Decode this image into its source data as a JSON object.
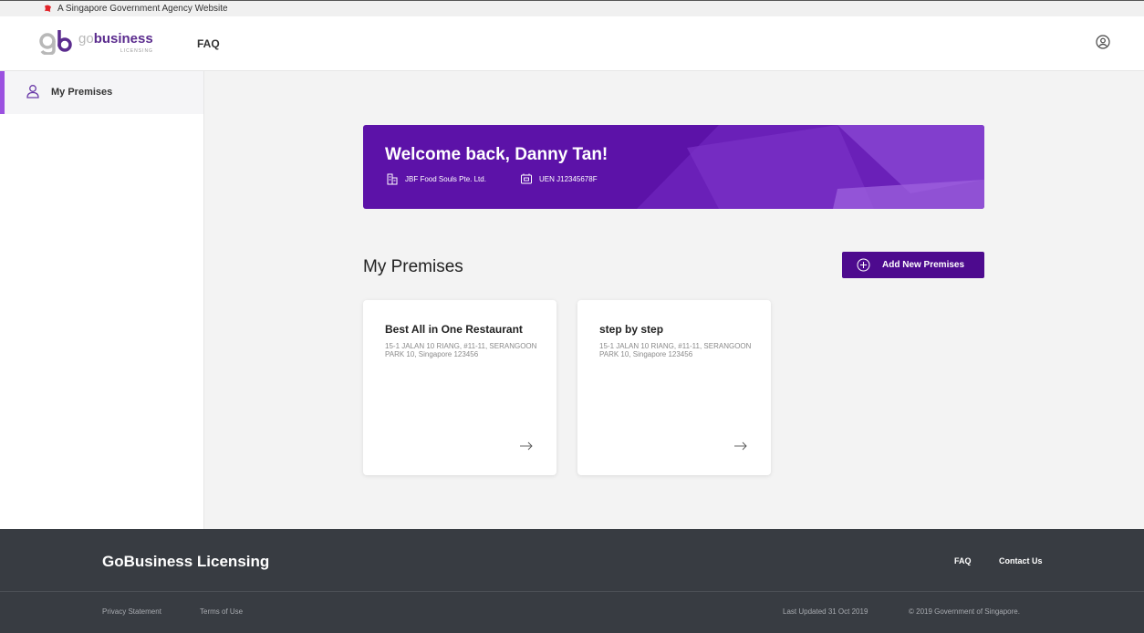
{
  "gov_bar": {
    "text": "A Singapore Government Agency Website"
  },
  "header": {
    "brand_go": "go",
    "brand_business": "business",
    "brand_sub": "LICENSING",
    "faq_label": "FAQ"
  },
  "sidebar": {
    "items": [
      {
        "label": "My Premises",
        "icon": "user-icon"
      }
    ]
  },
  "banner": {
    "title": "Welcome back, Danny Tan!",
    "company": "JBF Food Souls Pte. Ltd.",
    "uen": "UEN J12345678F"
  },
  "main": {
    "section_title": "My Premises",
    "add_button_label": "Add New Premises"
  },
  "premises": [
    {
      "name": "Best All in One Restaurant",
      "address": "15-1 JALAN 10 RIANG, #11-11, SERANGOON PARK 10, Singapore 123456"
    },
    {
      "name": "step by step",
      "address": "15-1 JALAN 10 RIANG, #11-11, SERANGOON PARK 10, Singapore 123456"
    }
  ],
  "footer": {
    "name": "GoBusiness Licensing",
    "links": [
      "FAQ",
      "Contact Us"
    ],
    "privacy": "Privacy Statement",
    "terms": "Terms of Use",
    "updated": "Last Updated 31 Oct 2019",
    "copyright": "© 2019 Government of Singapore."
  },
  "colors": {
    "brand_purple": "#5c12a8",
    "button_purple": "#4d0a8e",
    "sidebar_accent": "#9b51e0",
    "footer_bg": "#383c42"
  }
}
